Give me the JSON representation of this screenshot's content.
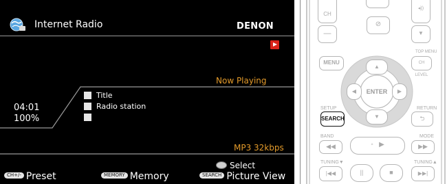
{
  "screen": {
    "app_title": "Internet Radio",
    "brand": "DENON",
    "status_label": "Now Playing",
    "elapsed_time": "04:01",
    "buffer_level": "100%",
    "info": [
      {
        "icon": "music-note-icon",
        "text": "Title"
      },
      {
        "icon": "radio-station-icon",
        "text": "Radio station"
      },
      {
        "icon": "clock-icon",
        "text": ""
      }
    ],
    "codec": "MP3 32kbps",
    "select_label": "Select",
    "footer": {
      "preset_key": "CH+/-",
      "preset_label": "Preset",
      "memory_key": "MEMORY",
      "memory_label": "Memory",
      "search_key": "SEARCH",
      "picture_label": "Picture View"
    },
    "colors": {
      "accent": "#e39a2a",
      "play_badge": "#d9231a"
    }
  },
  "remote": {
    "ch_label": "CH",
    "menu_label": "MENU",
    "top_menu_label": "TOP MENU",
    "ch_level_label": "CH LEVEL",
    "enter_label": "ENTER",
    "setup_label": "SETUP",
    "return_label": "RETURN",
    "search_label": "SEARCH",
    "band_label": "BAND",
    "mode_label": "MODE",
    "tuning_down_label": "TUNING",
    "tuning_up_label": "TUNING"
  }
}
